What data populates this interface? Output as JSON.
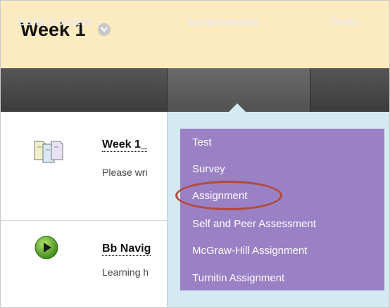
{
  "header": {
    "title": "Week 1"
  },
  "toolbar": {
    "items": [
      {
        "label": "Build Content"
      },
      {
        "label": "Assessments"
      },
      {
        "label": "Tools"
      }
    ],
    "caret": "⌄"
  },
  "content": {
    "items": [
      {
        "title": "Week 1_",
        "desc": "Please wri",
        "icon": "documents-icon"
      },
      {
        "title": "Bb Navig",
        "desc": "Learning h",
        "icon": "play-icon"
      }
    ]
  },
  "menu": {
    "items": [
      {
        "label": "Test"
      },
      {
        "label": "Survey"
      },
      {
        "label": "Assignment",
        "highlighted": true
      },
      {
        "label": "Self and Peer Assessment"
      },
      {
        "label": "McGraw-Hill Assignment"
      },
      {
        "label": "Turnitin Assignment"
      }
    ]
  },
  "colors": {
    "header_bg": "#fdebc0",
    "toolbar_bg": "#4a4a4a",
    "menu_bg": "#9a80c5",
    "dropdown_bg": "#d4e9f1",
    "highlight": "#b3493a"
  }
}
